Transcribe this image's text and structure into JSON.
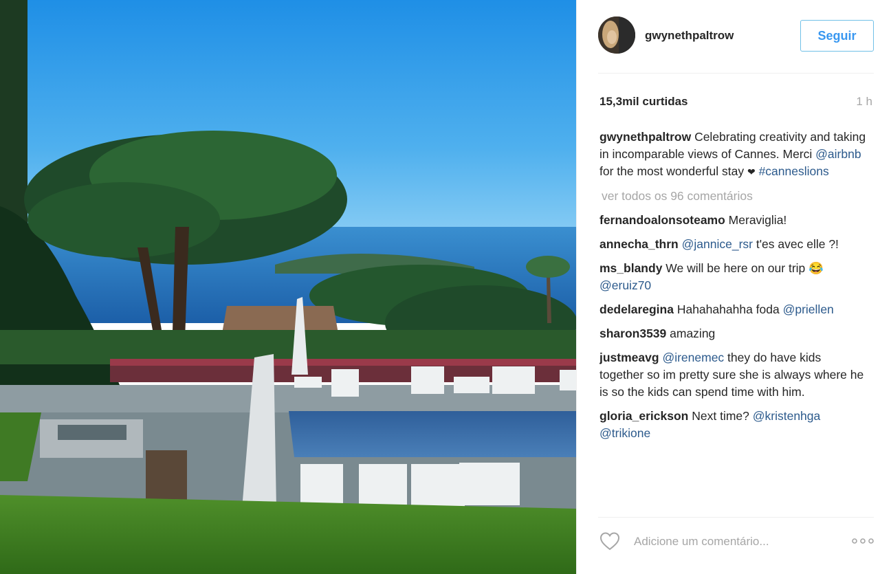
{
  "post": {
    "username": "gwynethpaltrow",
    "follow_label": "Seguir",
    "likes": "15,3mil curtidas",
    "time": "1 h",
    "caption": {
      "author": "gwynethpaltrow",
      "text_1": " Celebrating creativity and taking in incomparable views of Cannes. Merci ",
      "mention": "@airbnb",
      "text_2": " for the most wonderful stay ",
      "heart": "❤",
      "hashtag": "#canneslions"
    },
    "view_all": "ver todos os 96 comentários",
    "comments": [
      {
        "author": "fernandoalonsoteamo",
        "parts": [
          {
            "t": "text",
            "v": " Meraviglia!"
          }
        ]
      },
      {
        "author": "annecha_thrn",
        "parts": [
          {
            "t": "text",
            "v": " "
          },
          {
            "t": "mention",
            "v": "@jannice_rsr"
          },
          {
            "t": "text",
            "v": " t'es avec elle ?!"
          }
        ]
      },
      {
        "author": "ms_blandy",
        "parts": [
          {
            "t": "text",
            "v": " We will be here on our trip 😂 "
          },
          {
            "t": "mention",
            "v": "@eruiz70"
          }
        ]
      },
      {
        "author": "dedelaregina",
        "parts": [
          {
            "t": "text",
            "v": " Hahahahahha foda "
          },
          {
            "t": "mention",
            "v": "@priellen"
          }
        ]
      },
      {
        "author": "sharon3539",
        "parts": [
          {
            "t": "text",
            "v": " amazing"
          }
        ]
      },
      {
        "author": "justmeavg",
        "parts": [
          {
            "t": "text",
            "v": " "
          },
          {
            "t": "mention",
            "v": "@irenemec"
          },
          {
            "t": "text",
            "v": " they do have kids together so im pretty sure she is always where he is so the kids can spend time with him."
          }
        ]
      },
      {
        "author": "gloria_erickson",
        "parts": [
          {
            "t": "text",
            "v": " Next time? "
          },
          {
            "t": "mention",
            "v": "@kristenhga"
          },
          {
            "t": "text",
            "v": " "
          },
          {
            "t": "mention",
            "v": "@trikione"
          }
        ]
      }
    ],
    "comment_placeholder": "Adicione um comentário...",
    "icons": {
      "avatar": "avatar-image",
      "like": "heart-outline-icon",
      "more": "more-options-icon"
    }
  },
  "colors": {
    "link": "#2c5a8c",
    "follow": "#3897f0",
    "muted": "#a6a6a6"
  }
}
